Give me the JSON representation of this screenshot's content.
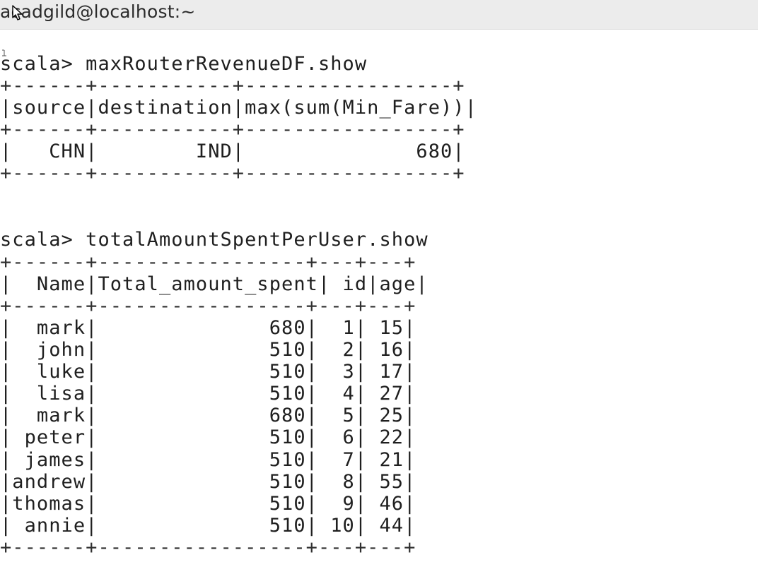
{
  "window": {
    "title": "acadgild@localhost:~"
  },
  "terminal": {
    "lines": [
      "",
      "scala> maxRouterRevenueDF.show",
      "+------+-----------+-----------------+",
      "|source|destination|max(sum(Min_Fare))|",
      "+------+-----------+-----------------+",
      "|   CHN|        IND|              680|",
      "+------+-----------+-----------------+",
      "",
      "",
      "scala> totalAmountSpentPerUser.show",
      "+------+-----------------+---+---+",
      "|  Name|Total_amount_spent| id|age|",
      "+------+-----------------+---+---+",
      "|  mark|              680|  1| 15|",
      "|  john|              510|  2| 16|",
      "|  luke|              510|  3| 17|",
      "|  lisa|              510|  4| 27|",
      "|  mark|              680|  5| 25|",
      "| peter|              510|  6| 22|",
      "| james|              510|  7| 21|",
      "|andrew|              510|  8| 55|",
      "|thomas|              510|  9| 46|",
      "| annie|              510| 10| 44|",
      "+------+-----------------+---+---+"
    ]
  }
}
